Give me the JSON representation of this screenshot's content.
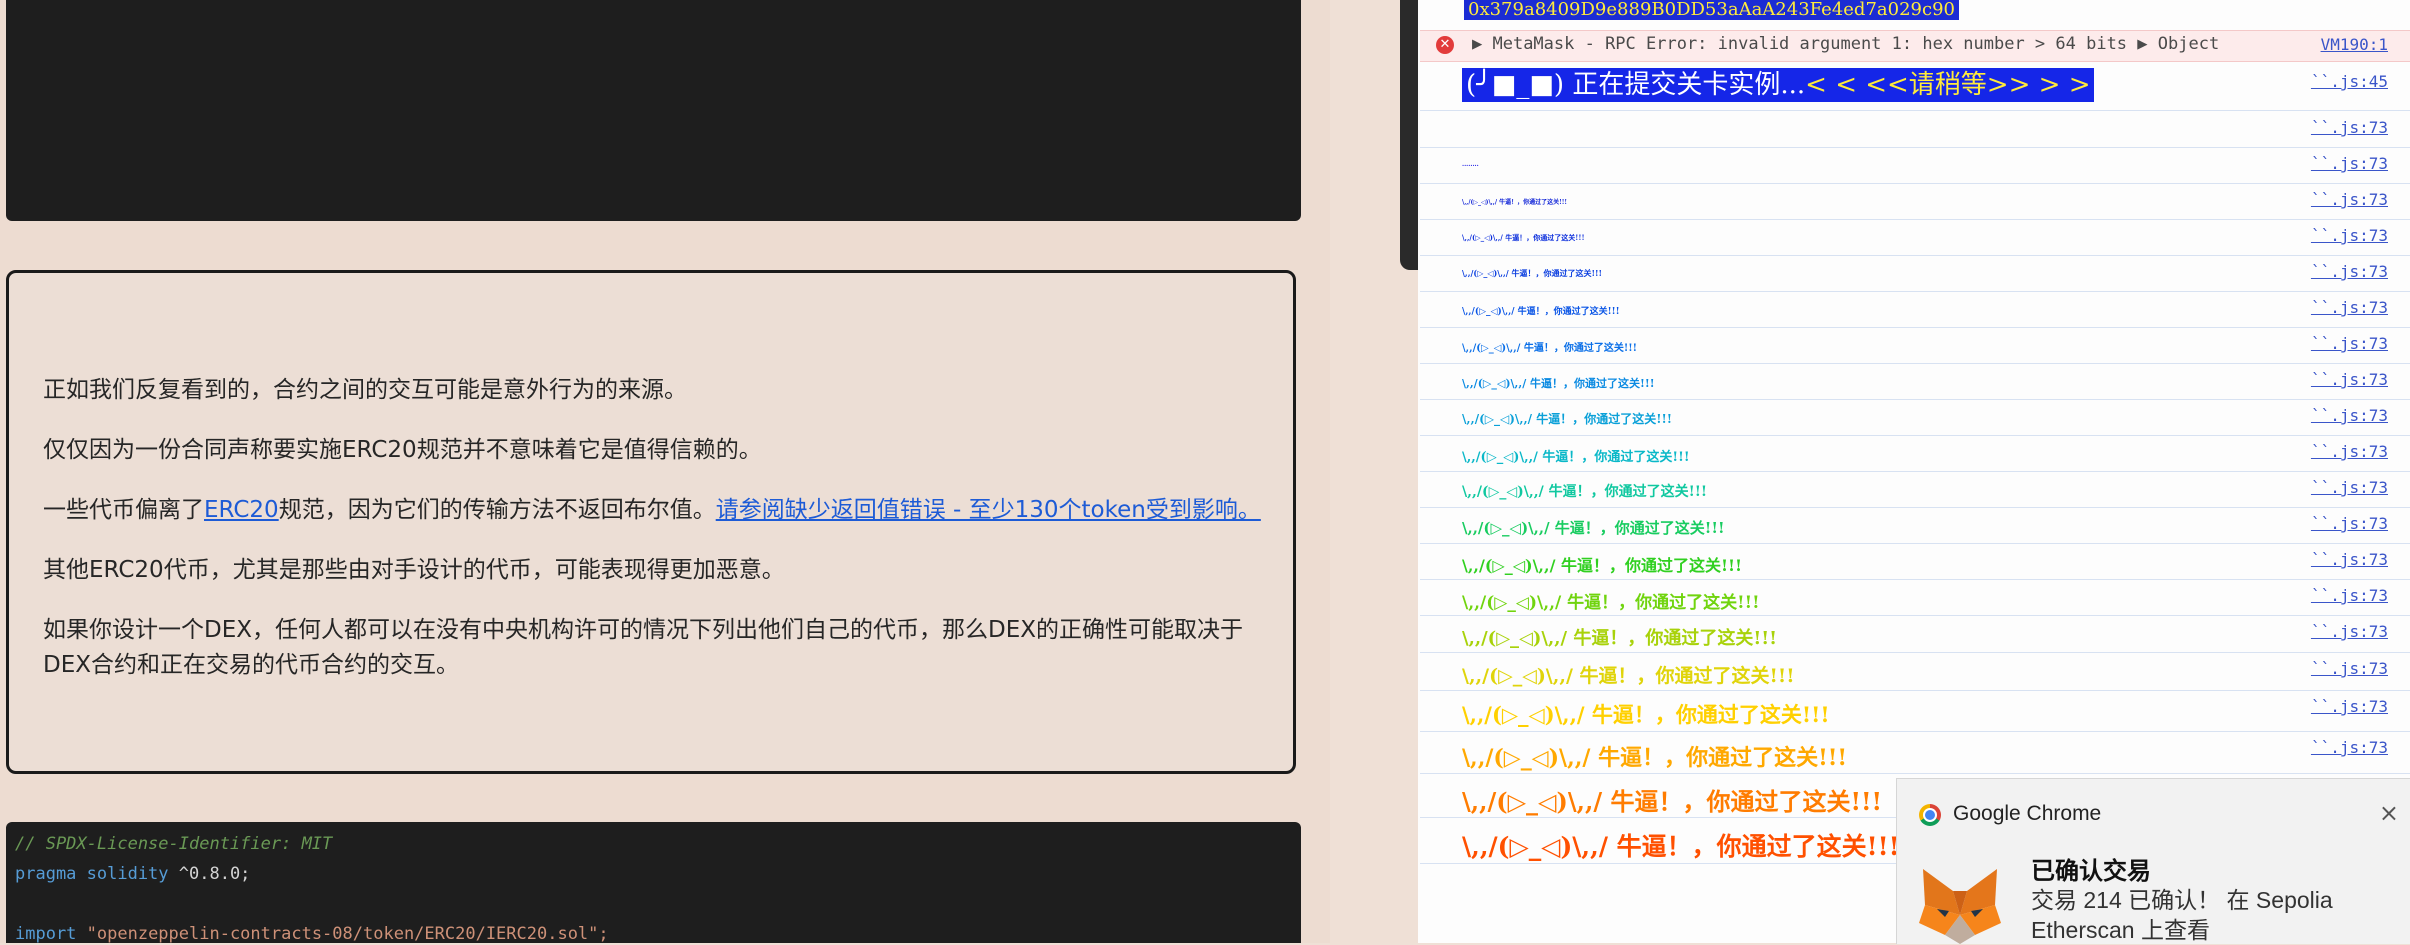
{
  "page": {
    "paragraphs": [
      "正如我们反复看到的，合约之间的交互可能是意外行为的来源。",
      "仅仅因为一份合同声称要实施ERC20规范并不意味着它是值得信赖的。"
    ],
    "p3_before": "一些代币偏离了",
    "p3_link1": "ERC20",
    "p3_middle": "规范，因为它们的传输方法不返回布尔值。",
    "p3_link2": "请参阅缺少返回值错误 - 至少130个token受到影响。",
    "p4": "其他ERC20代币，尤其是那些由对手设计的代币，可能表现得更加恶意。",
    "p5": "如果你设计一个DEX，任何人都可以在没有中央机构许可的情况下列出他们自己的代币，那么DEX的正确性可能取决于DEX合约和正在交易的代币合约的交互。"
  },
  "code": {
    "line1": "// SPDX-License-Identifier: MIT",
    "line2_kw": "pragma solidity",
    "line2_rest": " ^0.8.0;",
    "line3_kw": "import",
    "line3_str": " \"openzeppelin-contracts-08/token/ERC20/IERC20.sol\";"
  },
  "console": {
    "top_hash": "0x379a8409D9e889B0DD53aAaA243Fe4ed7a029c90",
    "error_text": "MetaMask - RPC Error: invalid argument 1: hex number > 64 bits",
    "error_object": "Object",
    "error_source": "VM190:1",
    "banner_face": "(╯■_■)",
    "banner_text": "正在提交关卡实例...",
    "banner_wait": "< < <<请稍等>> > >",
    "banner_source": "``.js:45",
    "log_source": "``.js:73",
    "log_messages": [
      "",
      "........",
      "\\,,/(▷_◁)\\,,/ 牛逼！，你通过了这关!!!",
      "\\,,/(▷_◁)\\,,/ 牛逼！，你通过了这关!!!",
      "\\,,/(▷_◁)\\,,/ 牛逼！，你通过了这关!!!",
      "\\,,/(▷_◁)\\,,/ 牛逼！，你通过了这关!!!",
      "\\,,/(▷_◁)\\,,/ 牛逼！，你通过了这关!!!",
      "\\,,/(▷_◁)\\,,/ 牛逼！，你通过了这关!!!",
      "\\,,/(▷_◁)\\,,/ 牛逼！，你通过了这关!!!",
      "\\,,/(▷_◁)\\,,/ 牛逼！，你通过了这关!!!",
      "\\,,/(▷_◁)\\,,/ 牛逼！，你通过了这关!!!",
      "\\,,/(▷_◁)\\,,/ 牛逼！，你通过了这关!!!",
      "\\,,/(▷_◁)\\,,/ 牛逼！，你通过了这关!!!",
      "\\,,/(▷_◁)\\,,/ 牛逼！，你通过了这关!!!",
      "\\,,/(▷_◁)\\,,/ 牛逼！，你通过了这关!!!",
      "\\,,/(▷_◁)\\,,/ 牛逼！，你通过了这关!!!",
      "\\,,/(▷_◁)\\,,/ 牛逼！，你通过了这关!!!",
      "\\,,/(▷_◁)\\,,/ 牛逼！，你通过了这关!!!",
      "\\,,/(▷_◁)\\,,/ 牛逼！，你通过了这关!!!",
      "\\,,/(▷_◁)\\,,/ 牛逼！，你通过了这关!!!"
    ],
    "log_colors": [
      "#0000ff",
      "#1a1ae6",
      "#0b1fd6",
      "#0a2ddc",
      "#0a3ee0",
      "#0a55e6",
      "#0a6fe8",
      "#0a8ae2",
      "#0aa0d8",
      "#0ab8c8",
      "#10c8a0",
      "#18cc60",
      "#30d020",
      "#70d40e",
      "#a8d20a",
      "#e0d40a",
      "#ffd000",
      "#ffa800",
      "#ff7c00",
      "#ff5000",
      "#ff2810",
      "#ff0000"
    ],
    "log_sizes": [
      4,
      6,
      6,
      7,
      8,
      9,
      10,
      11,
      12,
      13,
      14,
      15,
      16,
      17,
      18,
      19,
      21,
      22,
      24,
      25,
      27,
      28
    ]
  },
  "notification": {
    "app": "Google Chrome",
    "close": "×",
    "title": "已确认交易",
    "body": "交易 214 已确认！ 在 Sepolia Etherscan 上查看"
  }
}
